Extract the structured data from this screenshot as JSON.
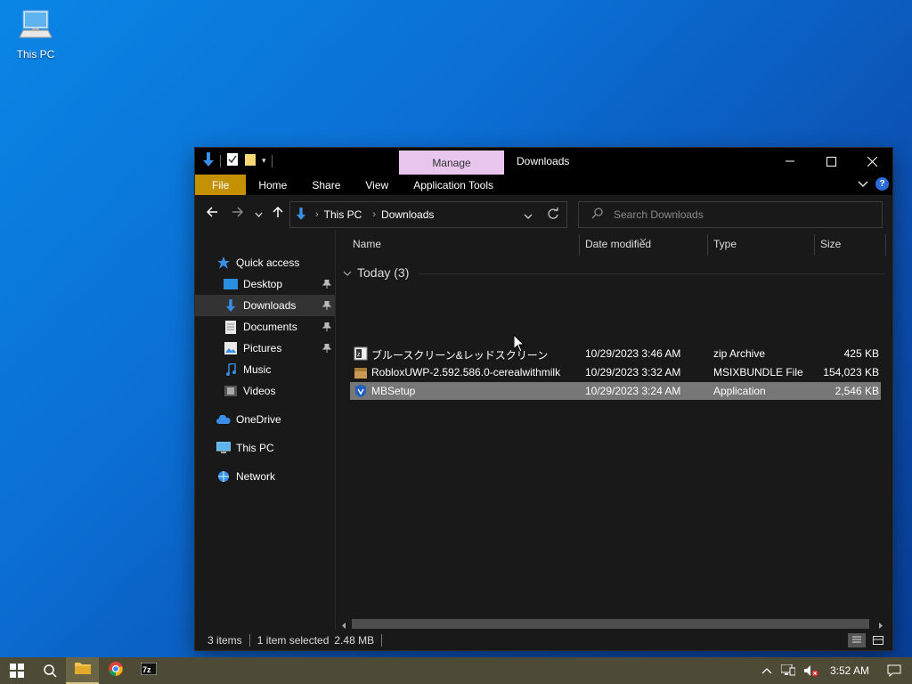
{
  "desktop": {
    "icon_label": "This PC"
  },
  "window": {
    "title": "Downloads",
    "manage_tab": "Manage",
    "ribbon_tabs": [
      "File",
      "Home",
      "Share",
      "View",
      "Application Tools"
    ],
    "address": {
      "root": "This PC",
      "folder": "Downloads"
    },
    "search_placeholder": "Search Downloads"
  },
  "navpane": {
    "quick_access": "Quick access",
    "items": [
      {
        "label": "Desktop",
        "pinned": true
      },
      {
        "label": "Downloads",
        "pinned": true,
        "selected": true
      },
      {
        "label": "Documents",
        "pinned": true
      },
      {
        "label": "Pictures",
        "pinned": true
      },
      {
        "label": "Music"
      },
      {
        "label": "Videos"
      }
    ],
    "onedrive": "OneDrive",
    "this_pc": "This PC",
    "network": "Network"
  },
  "columns": {
    "name": "Name",
    "date": "Date modified",
    "type": "Type",
    "size": "Size"
  },
  "group": {
    "label": "Today (3)"
  },
  "files": [
    {
      "name": "ブルースクリーン&レッドスクリーン",
      "date": "10/29/2023 3:46 AM",
      "type": "zip Archive",
      "size": "425 KB"
    },
    {
      "name": "RobloxUWP-2.592.586.0-cerealwithmilk",
      "date": "10/29/2023 3:32 AM",
      "type": "MSIXBUNDLE File",
      "size": "154,023 KB"
    },
    {
      "name": "MBSetup",
      "date": "10/29/2023 3:24 AM",
      "type": "Application",
      "size": "2,546 KB"
    }
  ],
  "status": {
    "items": "3 items",
    "selected": "1 item selected",
    "size": "2.48 MB"
  },
  "taskbar": {
    "time": "3:52 AM"
  }
}
